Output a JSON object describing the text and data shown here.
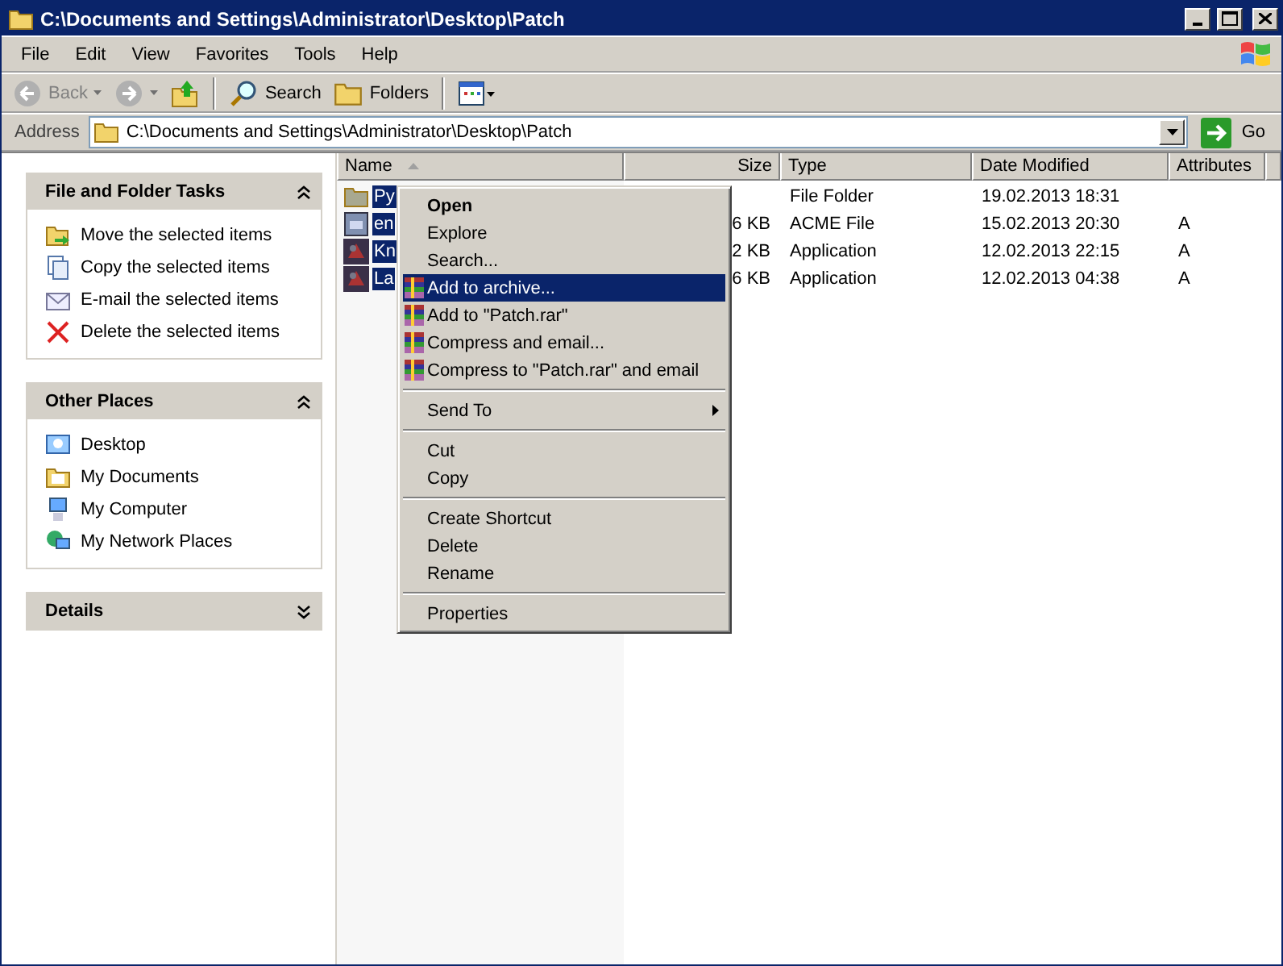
{
  "window": {
    "title": "C:\\Documents and Settings\\Administrator\\Desktop\\Patch"
  },
  "menu_bar": [
    "File",
    "Edit",
    "View",
    "Favorites",
    "Tools",
    "Help"
  ],
  "toolbar": [
    {
      "label": "Back",
      "kind": "back",
      "disabled": true
    },
    {
      "kind": "forward",
      "disabled": true
    },
    {
      "kind": "up"
    },
    {
      "label": "Search",
      "kind": "search"
    },
    {
      "label": "Folders",
      "kind": "folders"
    },
    {
      "kind": "views"
    }
  ],
  "address": {
    "label": "Address",
    "value": "C:\\Documents and Settings\\Administrator\\Desktop\\Patch",
    "go": "Go"
  },
  "panels": [
    {
      "title": "File and Folder Tasks",
      "expanded": true,
      "items": [
        {
          "label": "Move the selected items"
        },
        {
          "label": "Copy the selected items"
        },
        {
          "label": "E-mail the selected items"
        },
        {
          "label": "Delete the selected items"
        }
      ]
    },
    {
      "title": "Other Places",
      "expanded": true,
      "items": [
        {
          "label": "Desktop"
        },
        {
          "label": "My Documents"
        },
        {
          "label": "My Computer"
        },
        {
          "label": "My Network Places"
        }
      ]
    },
    {
      "title": "Details",
      "expanded": false
    }
  ],
  "table": {
    "columns": [
      "Name",
      "Size",
      "Type",
      "Date Modified",
      "Attributes"
    ],
    "rows": [
      {
        "kind": "folder",
        "name": "Py",
        "type": "File Folder",
        "date": "19.02.2013 18:31",
        "selected": true
      },
      {
        "kind": "file",
        "name": "en",
        "size": "6 KB",
        "type": "ACME File",
        "date": "15.02.2013 20:30",
        "attributes": "A",
        "selected": true
      },
      {
        "kind": "app",
        "name": "Kn",
        "size": "2 KB",
        "type": "Application",
        "date": "12.02.2013 22:15",
        "attributes": "A",
        "selected": true
      },
      {
        "kind": "app",
        "name": "La",
        "size": "6 KB",
        "type": "Application",
        "date": "12.02.2013 04:38",
        "attributes": "A",
        "selected": true
      }
    ]
  },
  "context_menu": [
    {
      "kind": "default",
      "label": "Open",
      "selected": false
    },
    {
      "kind": "command",
      "label": "Explore",
      "selected": false
    },
    {
      "kind": "command",
      "label": "Search...",
      "selected": false
    },
    {
      "kind": "archive",
      "label": "Add to archive...",
      "selected": true
    },
    {
      "kind": "archive",
      "label": "Add to \"Patch.rar\"",
      "selected": false
    },
    {
      "kind": "archive",
      "label": "Compress and email...",
      "selected": false
    },
    {
      "kind": "archive",
      "label": "Compress to \"Patch.rar\" and email",
      "selected": false
    },
    {
      "kind": "separator"
    },
    {
      "kind": "submenu",
      "label": "Send To",
      "selected": false
    },
    {
      "kind": "separator"
    },
    {
      "kind": "command",
      "label": "Cut",
      "selected": false
    },
    {
      "kind": "command",
      "label": "Copy",
      "selected": false
    },
    {
      "kind": "separator"
    },
    {
      "kind": "command",
      "label": "Create Shortcut",
      "selected": false
    },
    {
      "kind": "command",
      "label": "Delete",
      "selected": false
    },
    {
      "kind": "command",
      "label": "Rename",
      "selected": false
    },
    {
      "kind": "separator"
    },
    {
      "kind": "command",
      "label": "Properties",
      "selected": false
    }
  ]
}
